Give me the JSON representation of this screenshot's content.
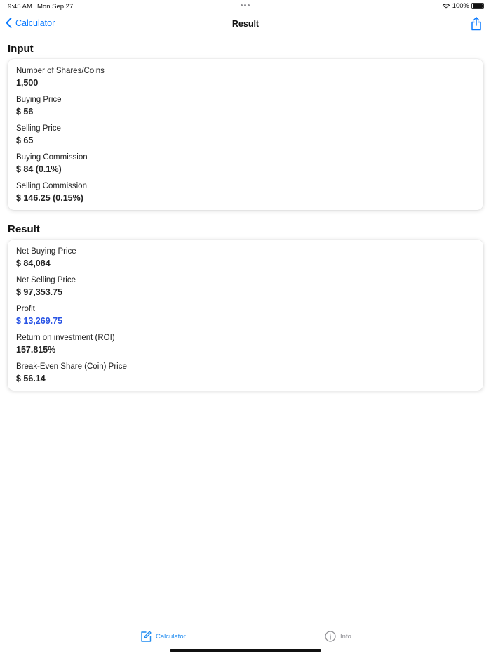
{
  "status_bar": {
    "time": "9:45 AM",
    "date": "Mon Sep 27",
    "battery": "100%"
  },
  "nav": {
    "back_label": "Calculator",
    "title": "Result"
  },
  "input": {
    "section_title": "Input",
    "fields": [
      {
        "label": "Number of Shares/Coins",
        "value": "1,500"
      },
      {
        "label": "Buying Price",
        "value": "$ 56"
      },
      {
        "label": "Selling Price",
        "value": "$ 65"
      },
      {
        "label": "Buying Commission",
        "value": "$ 84 (0.1%)"
      },
      {
        "label": "Selling Commission",
        "value": "$ 146.25 (0.15%)"
      }
    ]
  },
  "result": {
    "section_title": "Result",
    "fields": [
      {
        "label": "Net Buying Price",
        "value": "$ 84,084"
      },
      {
        "label": "Net Selling Price",
        "value": "$ 97,353.75"
      },
      {
        "label": "Profit",
        "value": "$ 13,269.75"
      },
      {
        "label": "Return on investment (ROI)",
        "value": "157.815%"
      },
      {
        "label": "Break-Even Share (Coin) Price",
        "value": "$ 56.14"
      }
    ]
  },
  "tabs": {
    "calculator_label": "Calculator",
    "info_label": "Info"
  },
  "colors": {
    "accent_blue": "#0a7aff",
    "profit_blue": "#2a55e5",
    "tab_active": "#1f8bf0",
    "tab_inactive": "#8e8e93"
  },
  "icons": [
    "chevron-left-icon",
    "share-icon",
    "wifi-icon",
    "battery-icon",
    "edit-icon",
    "info-icon"
  ]
}
